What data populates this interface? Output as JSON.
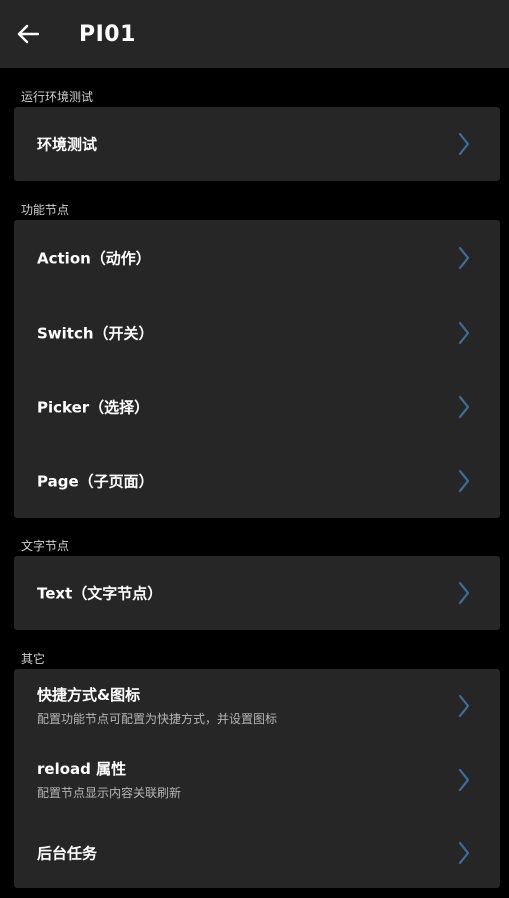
{
  "appbar": {
    "title": "PI01"
  },
  "sections": {
    "env": {
      "header": "运行环境测试",
      "items": [
        {
          "label": "环境测试"
        }
      ]
    },
    "nodes": {
      "header": "功能节点",
      "items": [
        {
          "label": "Action（动作）"
        },
        {
          "label": "Switch（开关）"
        },
        {
          "label": "Picker（选择）"
        },
        {
          "label": "Page（子页面）"
        }
      ]
    },
    "text": {
      "header": "文字节点",
      "items": [
        {
          "label": "Text（文字节点）"
        }
      ]
    },
    "other": {
      "header": "其它",
      "items": [
        {
          "label": "快捷方式&图标",
          "sub": "配置功能节点可配置为快捷方式，并设置图标"
        },
        {
          "label": "reload 属性",
          "sub": "配置节点显示内容关联刷新"
        },
        {
          "label": "后台任务"
        }
      ]
    }
  },
  "icons": {
    "back": "arrow-left-icon",
    "row_chevron": "chevron-right-icon"
  },
  "colors": {
    "appbar_bg": "#262626",
    "page_bg": "#000000",
    "card_bg": "#262626",
    "chevron": "#3d6e9e",
    "section_text": "#cfcfcf",
    "subtitle_text": "#b5b5b5"
  }
}
